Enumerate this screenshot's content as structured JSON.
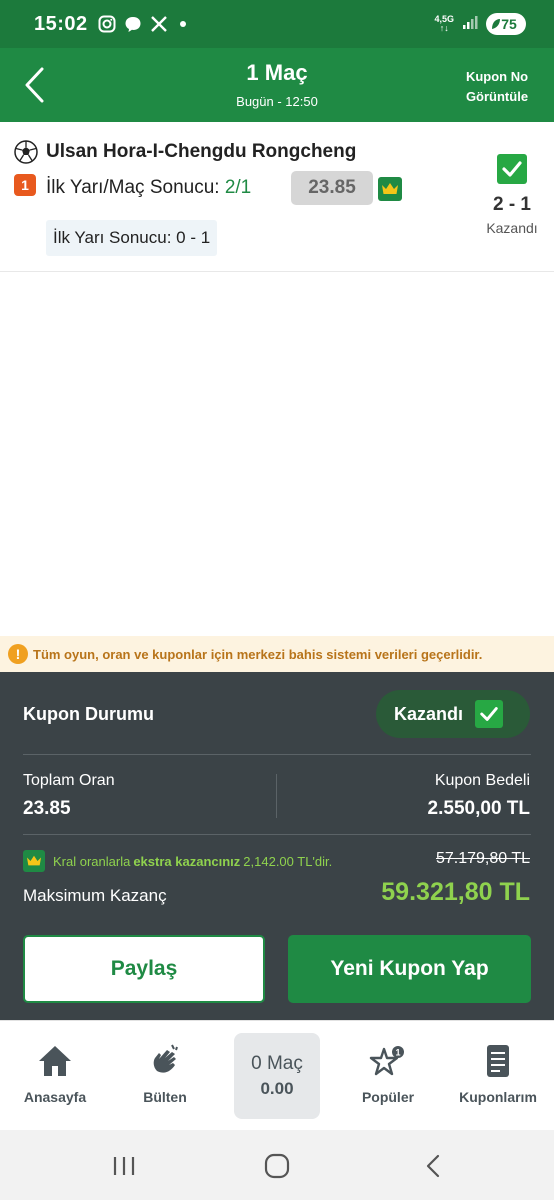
{
  "statusbar": {
    "time": "15:02",
    "network": "4,5G",
    "battery": "75"
  },
  "header": {
    "title": "1 Maç",
    "subtitle": "Bugün - 12:50",
    "kupon_no_line1": "Kupon No",
    "kupon_no_line2": "Görüntüle"
  },
  "match": {
    "teams": "Ulsan Hora-I-Chengdu Rongcheng",
    "number": "1",
    "market_label": "İlk Yarı/Maç Sonucu: ",
    "pick": "2/1",
    "odds": "23.85",
    "half_time": "İlk Yarı Sonucu: 0 - 1",
    "score": "2 - 1",
    "result": "Kazandı"
  },
  "notice": {
    "text": "Tüm oyun, oran ve kuponlar için merkezi bahis sistemi verileri geçerlidir."
  },
  "summary": {
    "status_label": "Kupon Durumu",
    "status_value": "Kazandı",
    "total_odds_label": "Toplam Oran",
    "total_odds_value": "23.85",
    "stake_label": "Kupon Bedeli",
    "stake_value": "2.550,00 TL",
    "kral_prefix": "Kral oranlarla",
    "kral_bold": "ekstra kazancınız",
    "kral_suffix": "2,142.00 TL'dir.",
    "old_max": "57.179,80 TL",
    "max_label": "Maksimum Kazanç",
    "max_value": "59.321,80 TL",
    "share_button": "Paylaş",
    "new_coupon_button": "Yeni Kupon Yap"
  },
  "bottomnav": {
    "home": "Anasayfa",
    "bulletin": "Bülten",
    "center_line1": "0 Maç",
    "center_line2": "0.00",
    "popular": "Popüler",
    "coupons": "Kuponlarım"
  },
  "colors": {
    "brand_green": "#1f8a44",
    "panel_bg": "#3b4347",
    "accent_lime": "#8fd24e",
    "badge_orange": "#e8591e"
  }
}
